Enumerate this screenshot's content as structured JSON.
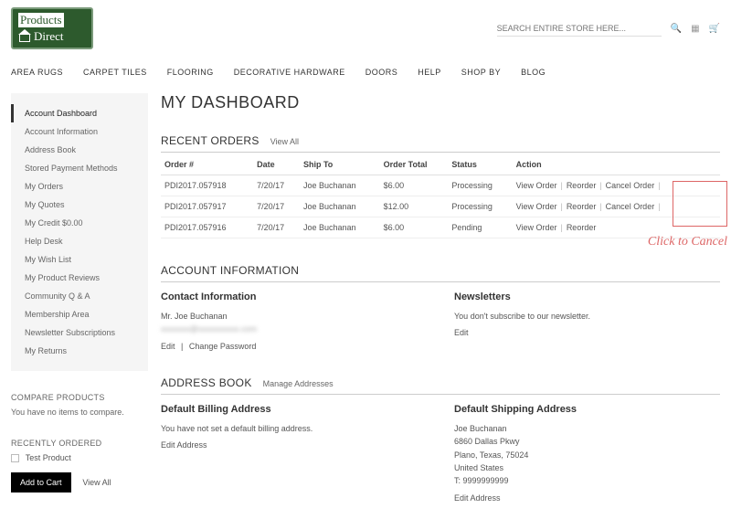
{
  "search": {
    "placeholder": "SEARCH ENTIRE STORE HERE..."
  },
  "logo": {
    "line1": "Products",
    "line2": "Direct"
  },
  "nav": [
    "AREA RUGS",
    "CARPET TILES",
    "FLOORING",
    "DECORATIVE HARDWARE",
    "DOORS",
    "HELP",
    "SHOP BY",
    "BLOG"
  ],
  "sidebar": {
    "items": [
      "Account Dashboard",
      "Account Information",
      "Address Book",
      "Stored Payment Methods",
      "My Orders",
      "My Quotes",
      "My Credit $0.00",
      "Help Desk",
      "My Wish List",
      "My Product Reviews",
      "Community Q & A",
      "Membership Area",
      "Newsletter Subscriptions",
      "My Returns"
    ],
    "compare_heading": "COMPARE PRODUCTS",
    "compare_text": "You have no items to compare.",
    "recent_heading": "RECENTLY ORDERED",
    "recent_item": "Test Product",
    "add_to_cart": "Add to Cart",
    "view_all": "View All"
  },
  "page_title": "MY DASHBOARD",
  "orders": {
    "heading": "RECENT ORDERS",
    "view_all": "View All",
    "columns": [
      "Order #",
      "Date",
      "Ship To",
      "Order Total",
      "Status",
      "Action"
    ],
    "action_labels": {
      "view": "View Order",
      "reorder": "Reorder",
      "cancel": "Cancel Order"
    },
    "rows": [
      {
        "num": "PDI2017.057918",
        "date": "7/20/17",
        "ship": "Joe Buchanan",
        "total": "$6.00",
        "status": "Processing",
        "cancelable": true
      },
      {
        "num": "PDI2017.057917",
        "date": "7/20/17",
        "ship": "Joe Buchanan",
        "total": "$12.00",
        "status": "Processing",
        "cancelable": true
      },
      {
        "num": "PDI2017.057916",
        "date": "7/20/17",
        "ship": "Joe Buchanan",
        "total": "$6.00",
        "status": "Pending",
        "cancelable": false
      }
    ],
    "annotation": "Click to Cancel"
  },
  "account": {
    "heading": "ACCOUNT INFORMATION",
    "contact_heading": "Contact Information",
    "name": "Mr. Joe Buchanan",
    "edit": "Edit",
    "change_pw": "Change Password",
    "news_heading": "Newsletters",
    "news_text": "You don't subscribe to our newsletter.",
    "news_edit": "Edit"
  },
  "address": {
    "heading": "ADDRESS BOOK",
    "manage": "Manage Addresses",
    "billing_heading": "Default Billing Address",
    "billing_text": "You have not set a default billing address.",
    "billing_edit": "Edit Address",
    "shipping_heading": "Default Shipping Address",
    "shipping_lines": [
      "Joe Buchanan",
      "6860 Dallas Pkwy",
      "Plano, Texas, 75024",
      "United States",
      "T: 9999999999"
    ],
    "shipping_edit": "Edit Address"
  }
}
